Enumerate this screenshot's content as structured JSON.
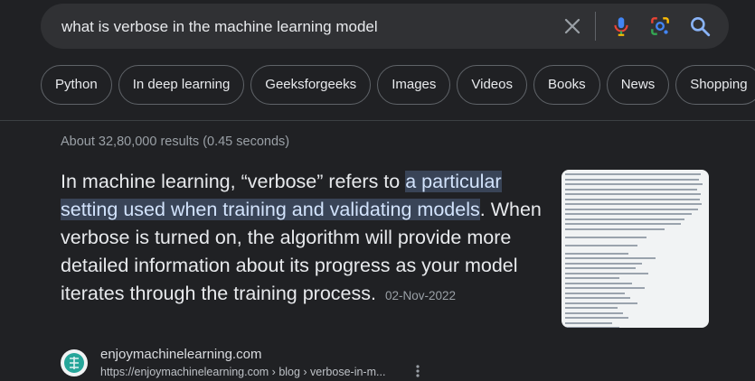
{
  "search": {
    "query": "what is verbose in the machine learning model"
  },
  "chips": [
    "Python",
    "In deep learning",
    "Geeksforgeeks",
    "Images",
    "Videos",
    "Books",
    "News",
    "Shopping"
  ],
  "results_stats": "About 32,80,000 results (0.45 seconds)",
  "snippet": {
    "before": "In machine learning, “verbose” refers to ",
    "highlight": "a particular setting used when training and validating models",
    "after": ". When verbose is turned on, the algorithm will provide more detailed information about its progress as your model iterates through the training process.",
    "date": "02-Nov-2022",
    "thumbnail_icon": "console-output-screenshot"
  },
  "source": {
    "site_name": "enjoymachinelearning.com",
    "url": "https://enjoymachinelearning.com › blog › verbose-in-m...",
    "favicon": "enjoymachinelearning-logo-icon"
  },
  "colors": {
    "background": "#202124",
    "search_bg": "#303134",
    "highlight_bg": "#394457",
    "mic_blue": "#4285f4",
    "mic_red": "#ea4335",
    "search_icon": "#8ab4f8",
    "favicon_teal": "#26a69a"
  }
}
